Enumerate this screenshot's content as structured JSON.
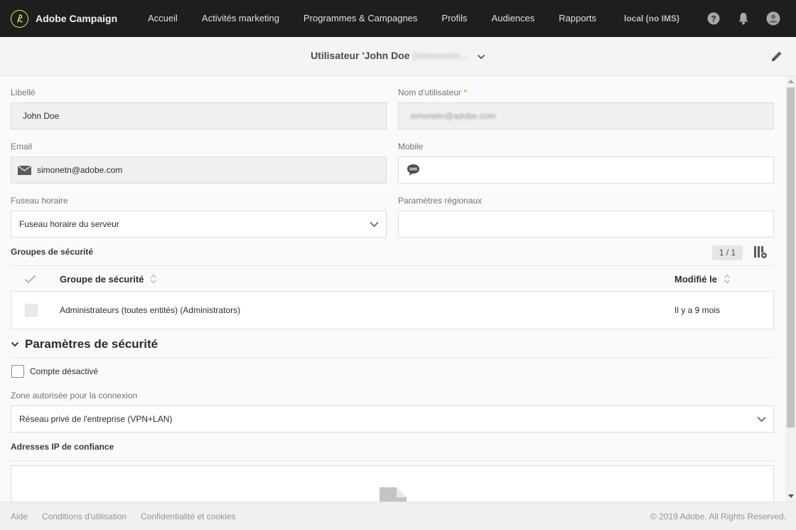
{
  "app": {
    "name": "Adobe Campaign"
  },
  "nav": {
    "items": [
      "Accueil",
      "Activités marketing",
      "Programmes & Campagnes",
      "Profils",
      "Audiences",
      "Rapports"
    ],
    "env": "local (no IMS)"
  },
  "header": {
    "title": "Utilisateur 'John Doe",
    "title_blurred": "(simonetn..."
  },
  "form": {
    "libelle": {
      "label": "Libellé",
      "value": "John Doe"
    },
    "username": {
      "label": "Nom d'utilisateur",
      "required": "*",
      "value": "simonetn@adobe.com"
    },
    "email": {
      "label": "Email",
      "value": "simonetn@adobe.com"
    },
    "mobile": {
      "label": "Mobile",
      "value": "",
      "badge": "SMS"
    },
    "timezone": {
      "label": "Fuseau horaire",
      "value": "Fuseau horaire du serveur"
    },
    "regional": {
      "label": "Paramètres régionaux",
      "value": ""
    }
  },
  "security_groups": {
    "title": "Groupes de sécurité",
    "pager": "1 / 1",
    "columns": [
      "Groupe de sécurité",
      "Modifié le"
    ],
    "rows": [
      {
        "name": "Administrateurs (toutes entités) (Administrators)",
        "modified": "Il y a 9 mois"
      }
    ]
  },
  "security_params": {
    "title": "Paramètres de sécurité",
    "disabled_label": "Compte désactivé",
    "zone": {
      "label": "Zone autorisée pour la connexion",
      "value": "Réseau privé de l'entreprise (VPN+LAN)"
    },
    "ip_title": "Adresses IP de confiance"
  },
  "footer": {
    "links": [
      "Aide",
      "Conditions d'utilisation",
      "Confidentialité et cookies"
    ],
    "copyright": "© 2019 Adobe. All Rights Reserved."
  },
  "colors": {
    "topbar": "#1e1e1e",
    "brand_accent": "#d7e34a",
    "required": "#e68619"
  },
  "icons": [
    "adobe-campaign-logo-icon",
    "help-icon",
    "bell-icon",
    "avatar-icon",
    "chevron-down-icon",
    "pencil-icon",
    "envelope-icon",
    "sms-icon",
    "column-settings-icon",
    "check-icon",
    "sort-icon",
    "document-icon"
  ]
}
